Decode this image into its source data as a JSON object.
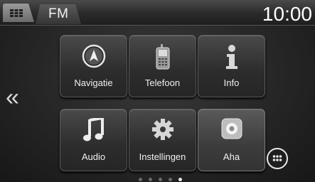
{
  "topbar": {
    "home_icon": "grid-icon",
    "source_label": "FM",
    "clock": "10:00"
  },
  "apps": [
    {
      "label": "Navigatie",
      "icon": "navigation-icon"
    },
    {
      "label": "Telefoon",
      "icon": "phone-icon"
    },
    {
      "label": "Info",
      "icon": "info-icon"
    },
    {
      "label": "Audio",
      "icon": "music-note-icon"
    },
    {
      "label": "Instellingen",
      "icon": "gear-icon"
    },
    {
      "label": "Aha",
      "icon": "aha-icon"
    }
  ],
  "nav": {
    "prev_glyph": "«",
    "menu_icon": "menu-grid-icon"
  },
  "pager": {
    "count": 5,
    "active": 4
  },
  "colors": {
    "background": "#262626",
    "tile": "#3a3a3a",
    "text": "#ffffff"
  }
}
